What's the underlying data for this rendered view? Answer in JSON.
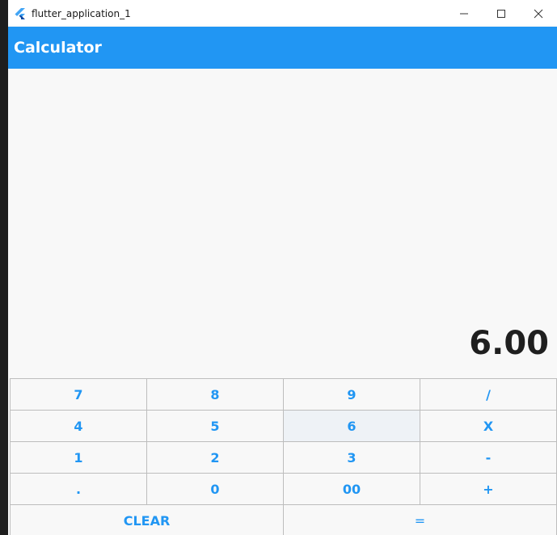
{
  "window": {
    "title": "flutter_application_1",
    "controls": [
      "minimize",
      "maximize",
      "close"
    ]
  },
  "appbar": {
    "title": "Calculator",
    "color": "#2196f3"
  },
  "display": {
    "result": "6.00"
  },
  "keypad": {
    "rows": [
      [
        "7",
        "8",
        "9",
        "/"
      ],
      [
        "4",
        "5",
        "6",
        "X"
      ],
      [
        "1",
        "2",
        "3",
        "-"
      ],
      [
        ".",
        "0",
        "00",
        "+"
      ]
    ],
    "bottom": [
      "CLEAR",
      "="
    ],
    "highlighted_key": "6"
  }
}
